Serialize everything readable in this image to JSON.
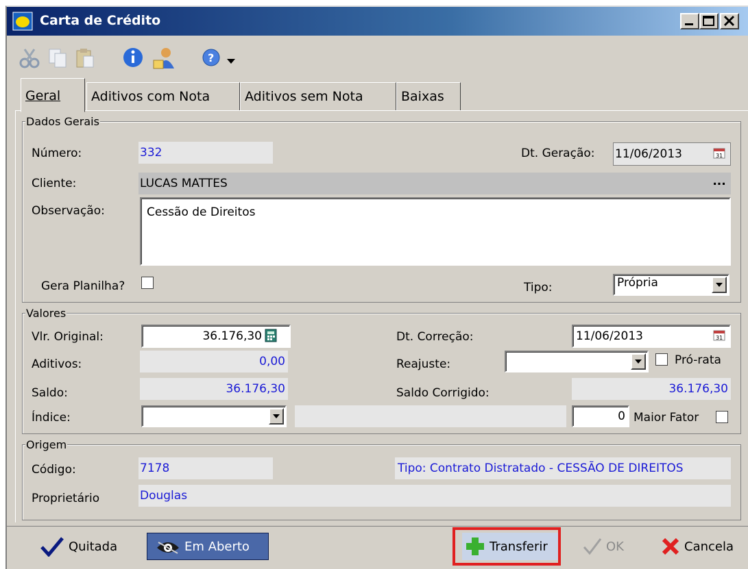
{
  "window": {
    "title": "Carta de Crédito"
  },
  "toolbar": {
    "icons": [
      "cut-icon",
      "copy-icon",
      "paste-icon",
      "info-icon",
      "user-icon",
      "help-icon",
      "dropdown-arrow-icon"
    ]
  },
  "tabs": [
    {
      "label": "Geral"
    },
    {
      "label": "Aditivos com Nota"
    },
    {
      "label": "Aditivos sem Nota"
    },
    {
      "label": "Baixas"
    }
  ],
  "dados_gerais": {
    "legend": "Dados Gerais",
    "numero_label": "Número:",
    "numero_value": "332",
    "dt_geracao_label": "Dt. Geração:",
    "dt_geracao_value": "11/06/2013",
    "cliente_label": "Cliente:",
    "cliente_value": "LUCAS MATTES",
    "cliente_btn": "...",
    "observacao_label": "Observação:",
    "observacao_value": "Cessão de Direitos",
    "gera_planilha_label": "Gera Planilha?",
    "tipo_label": "Tipo:",
    "tipo_value": "Própria"
  },
  "valores": {
    "legend": "Valores",
    "vlr_original_label": "Vlr. Original:",
    "vlr_original_value": "36.176,30",
    "dt_correcao_label": "Dt. Correção:",
    "dt_correcao_value": "11/06/2013",
    "aditivos_label": "Aditivos:",
    "aditivos_value": "0,00",
    "reajuste_label": "Reajuste:",
    "reajuste_value": "",
    "pro_rata_label": "Pró-rata",
    "saldo_label": "Saldo:",
    "saldo_value": "36.176,30",
    "saldo_corrigido_label": "Saldo Corrigido:",
    "saldo_corrigido_value": "36.176,30",
    "indice_label": "Índice:",
    "indice_value": "",
    "fator_value": "0",
    "maior_fator_label": "Maior Fator"
  },
  "origem": {
    "legend": "Origem",
    "codigo_label": "Código:",
    "codigo_value": "7178",
    "tipo_text": "Tipo: Contrato Distratado - CESSÃO DE DIREITOS",
    "proprietario_label": "Proprietário",
    "proprietario_value": "Douglas"
  },
  "bottom": {
    "quitada": "Quitada",
    "em_aberto": "Em Aberto",
    "transferir": "Transferir",
    "ok": "OK",
    "cancela": "Cancela"
  },
  "colors": {
    "highlight": "#e02020",
    "value_blue": "#1a1ad6",
    "title_bar": "#0a246a"
  }
}
